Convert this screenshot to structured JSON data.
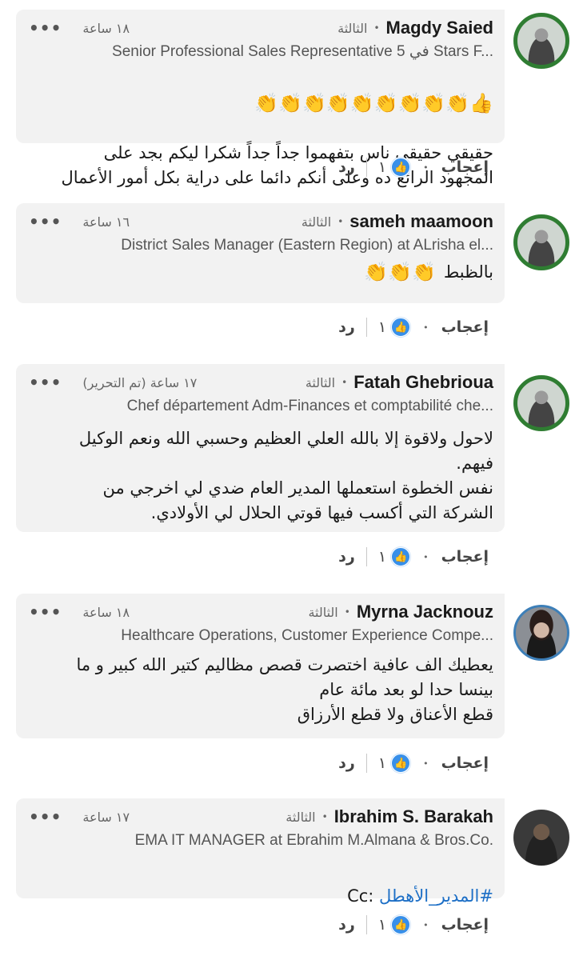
{
  "labels": {
    "like": "إعجاب",
    "reply": "رد",
    "more": "•••"
  },
  "comments": [
    {
      "name": "Magdy Saied",
      "degree": "الثالثة",
      "time": "١٨ ساعة",
      "headline": "Senior Professional Sales Representative في 5 Stars F...",
      "emojis": "👍👏👏👏👏👏👏👏👏👏",
      "text": "حقيقي حقيقي ناس بتفهموا جداً جداً شكرا ليكم بجد على\nالمجهود الرائع ده وعلى أنكم دائما على دراية بكل أمور الأعمال",
      "likes": "١",
      "open_to_work": true
    },
    {
      "name": "sameh maamoon",
      "degree": "الثالثة",
      "time": "١٦ ساعة",
      "headline": "District Sales Manager (Eastern Region) at ALrisha el...",
      "emojis": "👏👏👏",
      "text": "بالظبط",
      "likes": "١",
      "open_to_work": true
    },
    {
      "name": "Fatah Ghebrioua",
      "degree": "الثالثة",
      "time": "١٧ ساعة (تم التحرير)",
      "headline": "Chef département Adm-Finances et comptabilité che...",
      "text": "لاحول ولاقوة إلا بالله العلي العظيم وحسبي الله ونعم الوكيل\nفيهم.\nنفس الخطوة استعملها المدير العام ضدي لي اخرجي من\nالشركة التي أكسب فيها قوتي الحلال لي الأولادي.",
      "likes": "١",
      "open_to_work": true
    },
    {
      "name": "Myrna Jacknouz",
      "degree": "الثالثة",
      "time": "١٨ ساعة",
      "headline": "Healthcare Operations, Customer Experience Compe...",
      "text": "يعطيك الف عافية اختصرت  قصص مظاليم كتير الله كبير و ما\nبينسا حدا لو بعد مائة عام\nقطع الأعناق ولا قطع الأرزاق",
      "likes": "١",
      "open_to_work": false
    },
    {
      "name": "Ibrahim S. Barakah",
      "degree": "الثالثة",
      "time": "١٧ ساعة",
      "headline": "EMA IT MANAGER at Ebrahim M.Almana & Bros.Co.",
      "text_prefix": "Cc: ",
      "hashtag": "المدير_الأهطل#",
      "likes": "١",
      "open_to_work": false
    }
  ],
  "otw_badge": "#OPENTOWORK"
}
